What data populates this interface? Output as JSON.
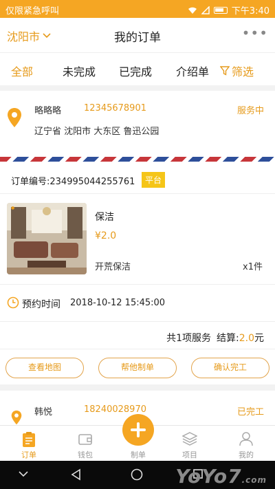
{
  "status_bar": {
    "carrier": "仅限紧急呼叫",
    "time": "下午3:40"
  },
  "header": {
    "city": "沈阳市",
    "title": "我的订单"
  },
  "tabs": [
    {
      "label": "全部",
      "active": true
    },
    {
      "label": "未完成"
    },
    {
      "label": "已完成"
    },
    {
      "label": "介绍单"
    },
    {
      "label": "筛选"
    }
  ],
  "address_card": {
    "name": "略略略",
    "phone": "12345678901",
    "status": "服务中",
    "address": "辽宁省 沈阳市 大东区 鲁迅公园"
  },
  "order": {
    "order_number": "订单编号:234995044255761",
    "badge": "平台",
    "service_name": "保洁",
    "price": "¥2.0",
    "subtitle": "开荒保洁",
    "quantity": "x1件",
    "appointment_label": "预约时间",
    "appointment_time": "2018-10-12 15:45:00",
    "summary_count": "共1项服务",
    "summary_label": "结算:",
    "summary_amount": "2.0",
    "summary_unit": "元",
    "buttons": {
      "view_map": "查看地图",
      "help_order": "帮他制单",
      "confirm_done": "确认完工"
    }
  },
  "second_card": {
    "name": "韩悦",
    "phone": "18240028970",
    "status": "已完工"
  },
  "bottom_nav": [
    {
      "label": "订单",
      "active": true
    },
    {
      "label": "钱包"
    },
    {
      "label": "制单"
    },
    {
      "label": "项目"
    },
    {
      "label": "我的"
    }
  ],
  "watermark": {
    "text": "YoYo7",
    "suffix": ".com"
  },
  "colors": {
    "accent": "#f5a623",
    "accent_text": "#e69a1a",
    "badge": "#f5c518",
    "airmail_red": "#c7363a",
    "airmail_blue": "#2e4f9a"
  }
}
